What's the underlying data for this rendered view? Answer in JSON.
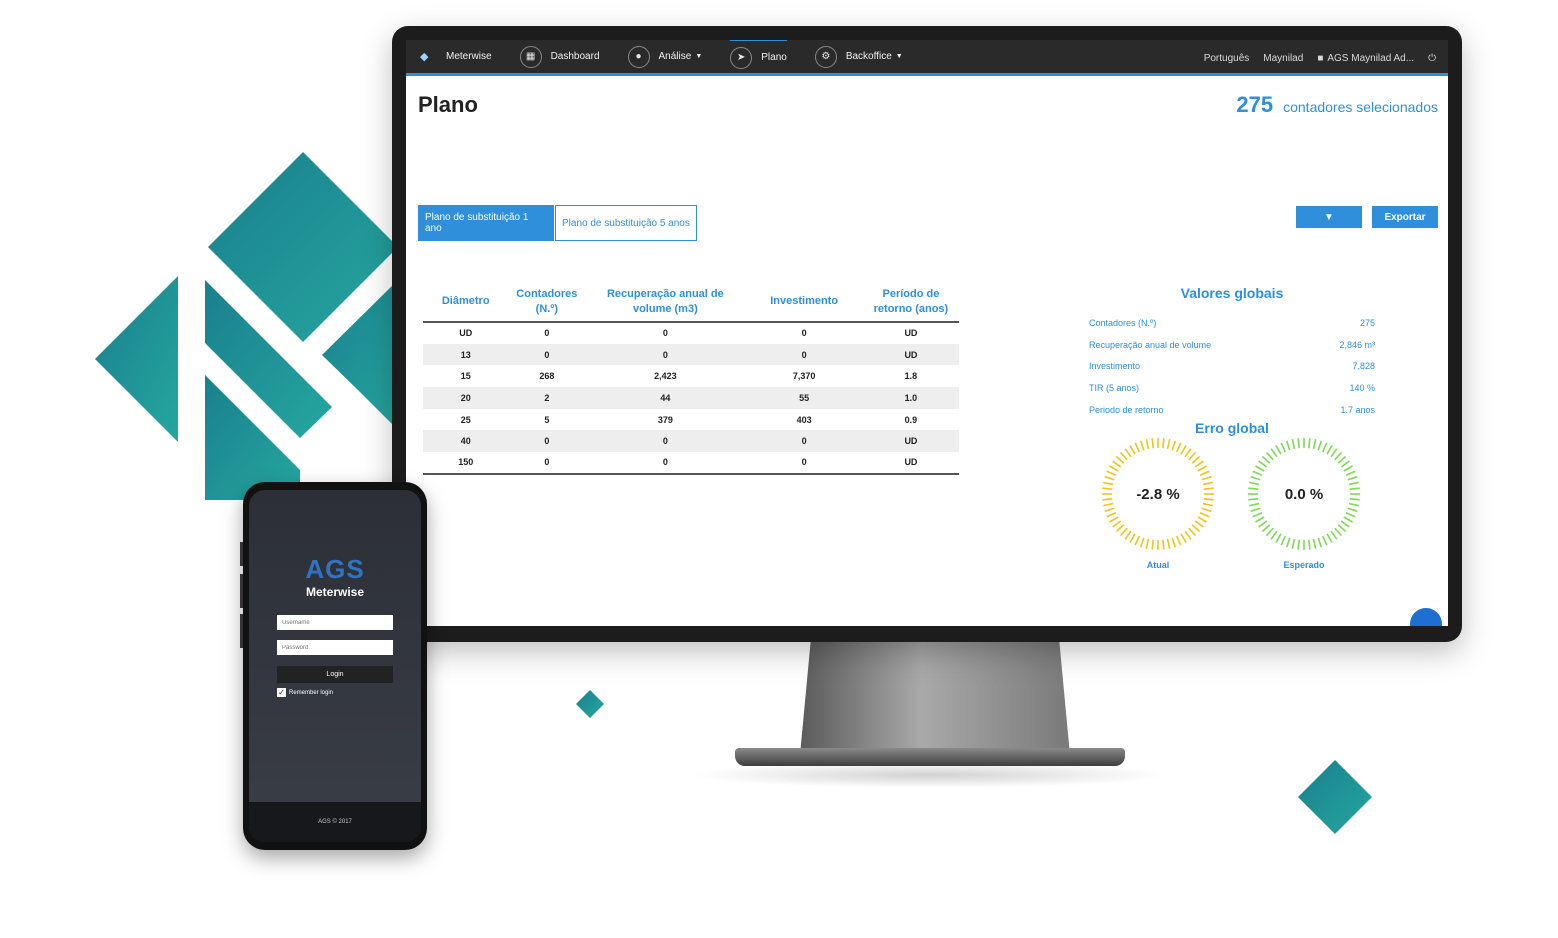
{
  "colors": {
    "accent": "#2f8fdb",
    "teal": "#1f9aa0",
    "gauge_yellow": "#f0c419",
    "gauge_green": "#7ed957"
  },
  "navbar": {
    "brand": "Meterwise",
    "items": [
      {
        "label": "Dashboard",
        "icon": "grid-icon"
      },
      {
        "label": "Análise",
        "icon": "drop-icon",
        "dropdown": true
      },
      {
        "label": "Plano",
        "icon": "navigation-icon",
        "active": true
      },
      {
        "label": "Backoffice",
        "icon": "gears-icon",
        "dropdown": true
      }
    ],
    "language": "Português",
    "org": "Maynilad",
    "user": "AGS Maynilad Ad...",
    "user_icon": "user-icon",
    "power_icon": "power-icon"
  },
  "page": {
    "title": "Plano",
    "selected_count": "275",
    "selected_label": "contadores selecionados"
  },
  "tabs": [
    "Plano de substituição 1 ano",
    "Plano de substituição 5 anos"
  ],
  "toolbar": {
    "dropdown_icon": "caret-down-icon",
    "export_label": "Exportar"
  },
  "table": {
    "headers": [
      "Diâmetro",
      "Contadores (N.º)",
      "Recuperação anual de volume (m3)",
      "Investimento",
      "Período de retorno (anos)"
    ],
    "rows": [
      [
        "UD",
        "0",
        "0",
        "0",
        "UD"
      ],
      [
        "13",
        "0",
        "0",
        "0",
        "UD"
      ],
      [
        "15",
        "268",
        "2,423",
        "7,370",
        "1.8"
      ],
      [
        "20",
        "2",
        "44",
        "55",
        "1.0"
      ],
      [
        "25",
        "5",
        "379",
        "403",
        "0.9"
      ],
      [
        "40",
        "0",
        "0",
        "0",
        "UD"
      ],
      [
        "150",
        "0",
        "0",
        "0",
        "UD"
      ]
    ]
  },
  "global_values": {
    "title": "Valores globais",
    "rows": [
      {
        "label": "Contadores (N.º)",
        "value": "275"
      },
      {
        "label": "Recuperação anual de volume",
        "value": "2,846 m³"
      },
      {
        "label": "Investimento",
        "value": "7,828"
      },
      {
        "label": "TIR (5 anos)",
        "value": "140 %"
      },
      {
        "label": "Periodo de retorno",
        "value": "1.7 anos"
      }
    ]
  },
  "global_error": {
    "title": "Erro global",
    "gauges": [
      {
        "value": "-2.8 %",
        "label": "Atual",
        "color": "#f0c419"
      },
      {
        "value": "0.0 %",
        "label": "Esperado",
        "color": "#7ed957"
      }
    ]
  },
  "phone": {
    "logo": "AGS",
    "app_name": "Meterwise",
    "username_placeholder": "Username",
    "password_placeholder": "Password",
    "login_label": "Login",
    "remember_label": "Remember login",
    "footer": "AGS © 2017"
  }
}
